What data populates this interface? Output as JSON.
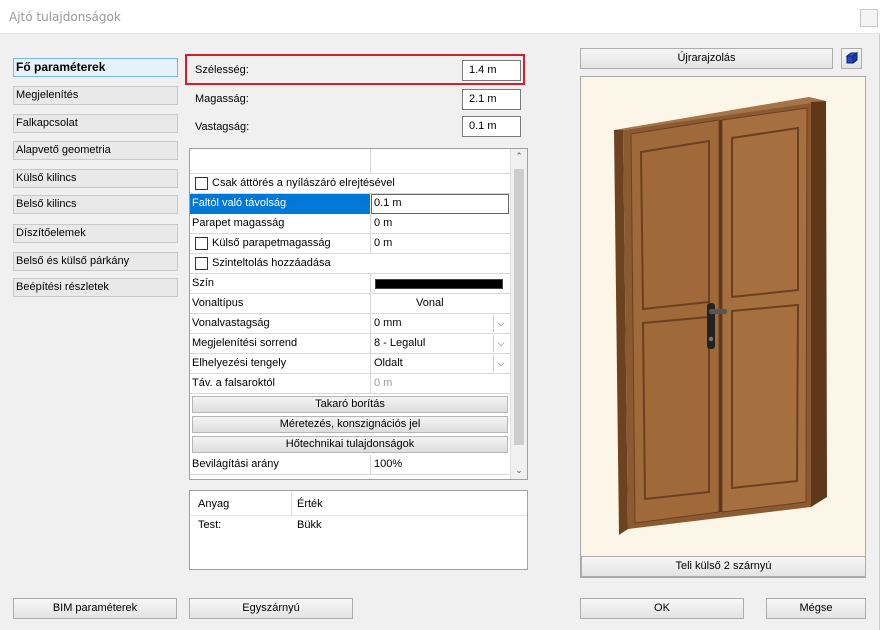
{
  "window": {
    "title": "Ajtó tulajdonságok"
  },
  "sidebar": {
    "items": [
      {
        "label": "Fő paraméterek"
      },
      {
        "label": "Megjelenítés"
      },
      {
        "label": "Falkapcsolat"
      },
      {
        "label": "Alapvető geometria"
      },
      {
        "label": "Külső kilincs"
      },
      {
        "label": "Belső kilincs"
      },
      {
        "label": "Díszítőelemek"
      },
      {
        "label": "Belső és külső párkány"
      },
      {
        "label": "Beépítési részletek"
      }
    ]
  },
  "params": {
    "width_label": "Szélesség:",
    "width_value": "1.4 m",
    "height_label": "Magasság:",
    "height_value": "2.1 m",
    "thickness_label": "Vastagság:",
    "thickness_value": "0.1 m"
  },
  "grid": {
    "rows": [
      {
        "label": "Csak áttörés a nyílászáró elrejtésével"
      },
      {
        "label": "Faltól való távolság",
        "value": "0.1 m"
      },
      {
        "label": "Parapet magasság",
        "value": "0 m"
      },
      {
        "label": "Külső parapetmagasság",
        "value": "0 m"
      },
      {
        "label": "Szinteltolás hozzáadása"
      },
      {
        "label": "Szín"
      },
      {
        "label": "Vonaltípus",
        "value": "Vonal"
      },
      {
        "label": "Vonalvastagság",
        "value": "0 mm"
      },
      {
        "label": "Megjelenítési sorrend",
        "value": "8 - Legalul"
      },
      {
        "label": "Elhelyezési tengely",
        "value": "Oldalt"
      },
      {
        "label": "Táv. a falsaroktól",
        "value": "0 m"
      }
    ],
    "sections": [
      "Takaró borítás",
      "Méretezés, konszignációs jel",
      "Hőtechnikai tulajdonságok"
    ],
    "tail_rows": [
      {
        "label": "Bevilágítási arány",
        "value": "100%"
      }
    ],
    "colors": {
      "selected": "#0078d7",
      "swatch": "#000000"
    }
  },
  "materials": {
    "col_material": "Anyag",
    "col_value": "Érték",
    "rows": [
      {
        "material": "Test:",
        "value": "Bükk"
      }
    ]
  },
  "preview": {
    "redraw_label": "Újrarajzolás",
    "type_label": "Teli külső 2 szárnyú",
    "door_color": "#8b5a30"
  },
  "footer": {
    "bim_label": "BIM paraméterek",
    "single_label": "Egyszárnyú",
    "ok_label": "OK",
    "cancel_label": "Mégse"
  }
}
